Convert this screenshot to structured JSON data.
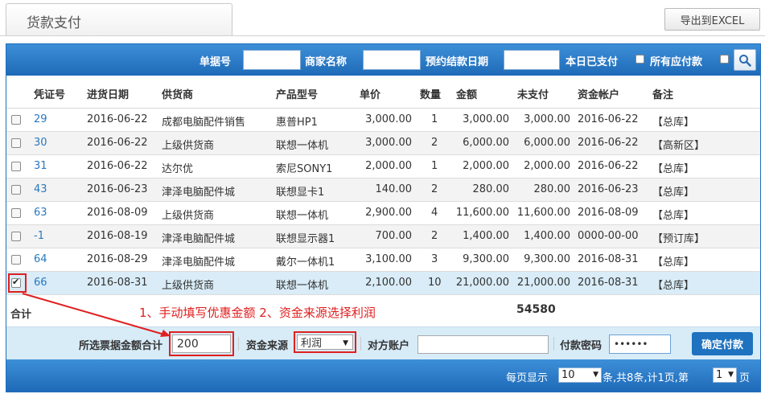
{
  "page": {
    "tab_title": "货款支付",
    "export_label": "导出到EXCEL"
  },
  "filters": {
    "doc_no_label": "单据号",
    "vendor_label": "商家名称",
    "settle_date_label": "预约结款日期",
    "paid_today_label": "本日已支付",
    "all_payable_label": "所有应付款",
    "search_icon": "search-icon"
  },
  "table": {
    "headers": [
      "凭证号",
      "进货日期",
      "供货商",
      "产品型号",
      "单价",
      "数量",
      "金额",
      "未支付",
      "资金帐户",
      "备注"
    ],
    "rows": [
      {
        "voucher": "29",
        "date": "2016-06-22",
        "supplier": "成都电脑配件销售",
        "model": "惠普HP1",
        "price": "3,000.00",
        "qty": "1",
        "amount": "3,000.00",
        "unpaid": "3,000.00",
        "account": "2016-06-22",
        "note": "【总库】",
        "checked": false
      },
      {
        "voucher": "30",
        "date": "2016-06-22",
        "supplier": "上级供货商",
        "model": "联想一体机",
        "price": "3,000.00",
        "qty": "2",
        "amount": "6,000.00",
        "unpaid": "6,000.00",
        "account": "2016-06-22",
        "note": "【高新区】",
        "checked": false
      },
      {
        "voucher": "31",
        "date": "2016-06-22",
        "supplier": "达尔优",
        "model": "索尼SONY1",
        "price": "2,000.00",
        "qty": "1",
        "amount": "2,000.00",
        "unpaid": "2,000.00",
        "account": "2016-06-22",
        "note": "【总库】",
        "checked": false
      },
      {
        "voucher": "43",
        "date": "2016-06-23",
        "supplier": "津泽电脑配件城",
        "model": "联想显卡1",
        "price": "140.00",
        "qty": "2",
        "amount": "280.00",
        "unpaid": "280.00",
        "account": "2016-06-23",
        "note": "【总库】",
        "checked": false
      },
      {
        "voucher": "63",
        "date": "2016-08-09",
        "supplier": "上级供货商",
        "model": "联想一体机",
        "price": "2,900.00",
        "qty": "4",
        "amount": "11,600.00",
        "unpaid": "11,600.00",
        "account": "2016-08-09",
        "note": "【总库】",
        "checked": false
      },
      {
        "voucher": "-1",
        "date": "2016-08-19",
        "supplier": "津泽电脑配件城",
        "model": "联想显示器1",
        "price": "700.00",
        "qty": "2",
        "amount": "1,400.00",
        "unpaid": "1,400.00",
        "account": "0000-00-00",
        "note": "【预订库】",
        "checked": false
      },
      {
        "voucher": "64",
        "date": "2016-08-29",
        "supplier": "津泽电脑配件城",
        "model": "戴尔一体机1",
        "price": "3,100.00",
        "qty": "3",
        "amount": "9,300.00",
        "unpaid": "9,300.00",
        "account": "2016-08-31",
        "note": "【总库】",
        "checked": false
      },
      {
        "voucher": "66",
        "date": "2016-08-31",
        "supplier": "上级供货商",
        "model": "联想一体机",
        "price": "2,100.00",
        "qty": "10",
        "amount": "21,000.00",
        "unpaid": "21,000.00",
        "account": "2016-08-31",
        "note": "【总库】",
        "checked": true
      }
    ],
    "total_label": "合计",
    "total_unpaid": "54580"
  },
  "annotation": "1、手动填写优惠金额  2、资金来源选择利润",
  "payment": {
    "selected_total_label": "所选票据金额合计",
    "selected_total_value": "200",
    "fund_source_label": "资金来源",
    "fund_source_value": "利润",
    "counter_account_label": "对方账户",
    "counter_account_value": "",
    "pay_password_label": "付款密码",
    "pay_password_value": "••••••",
    "confirm_label": "确定付款"
  },
  "pagination": {
    "per_page_label": "每页显示",
    "per_page_value": "10",
    "summary": "条,共8条,计1页,第",
    "page_value": "1",
    "page_suffix": "页"
  },
  "colors": {
    "header_blue": "#1e6ab8",
    "accent_red": "#e02020",
    "link_blue": "#2878c0"
  }
}
